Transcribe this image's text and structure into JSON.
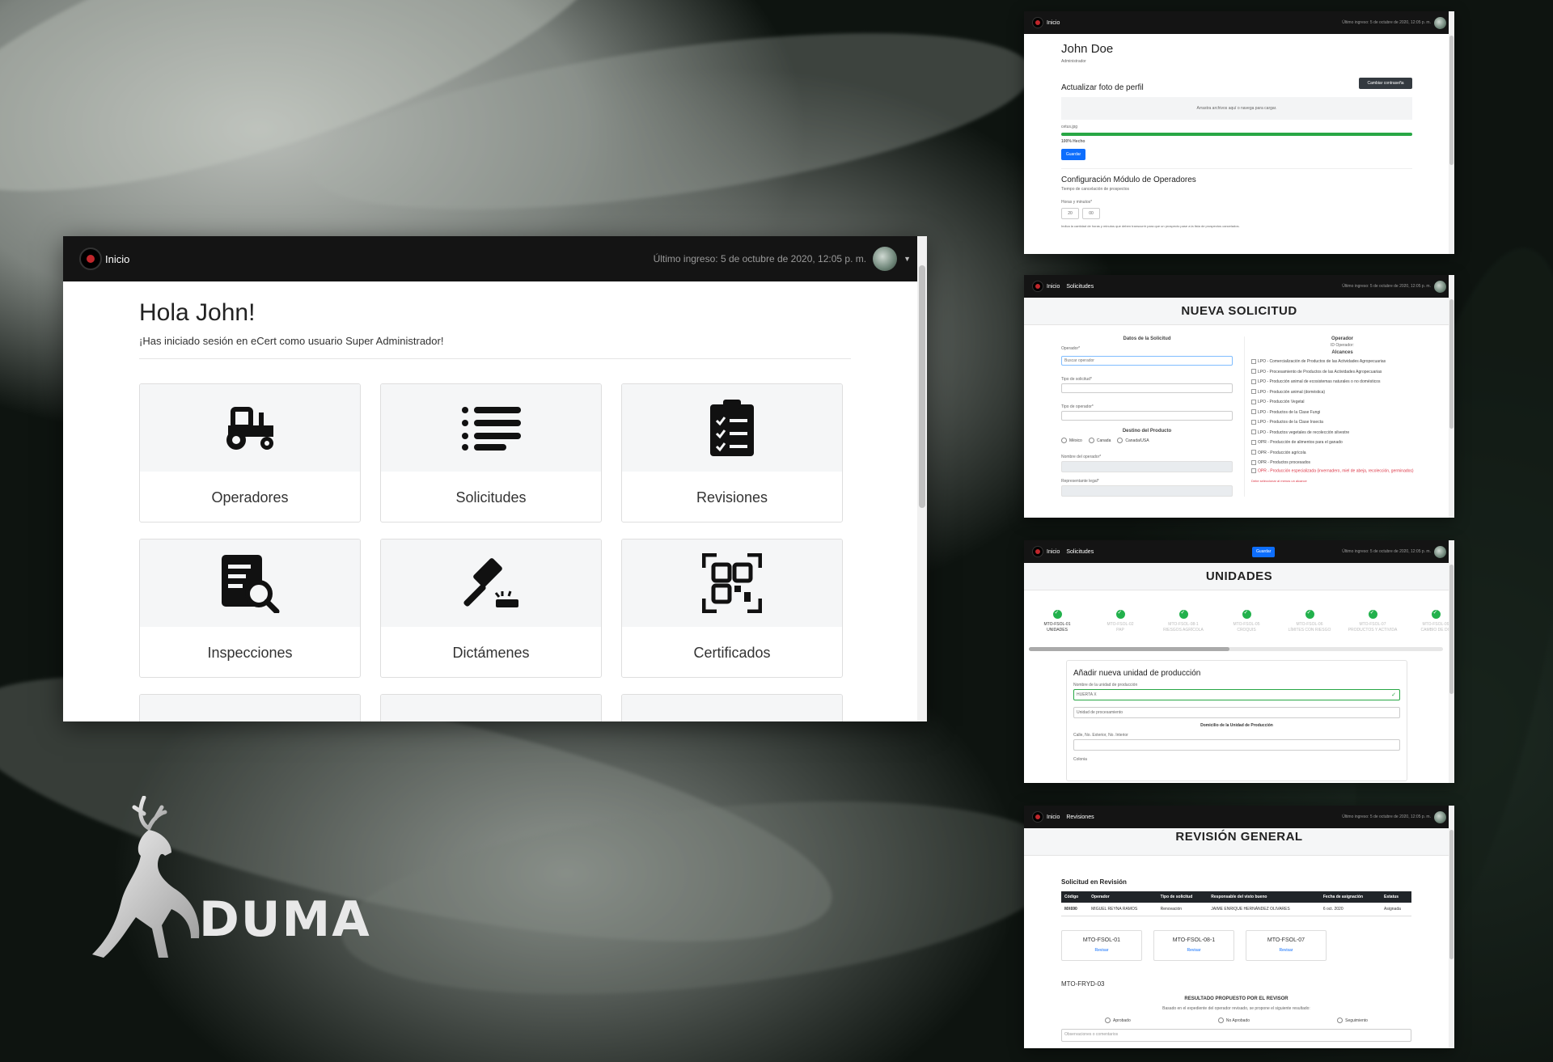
{
  "main": {
    "brand": "Inicio",
    "last_login": "Último ingreso: 5 de octubre de 2020, 12:05 p. m.",
    "greeting": "Hola John!",
    "subtitle": "¡Has iniciado sesión en eCert como usuario Super Administrador!",
    "cards": [
      {
        "label": "Operadores",
        "icon": "tractor-icon"
      },
      {
        "label": "Solicitudes",
        "icon": "list-icon"
      },
      {
        "label": "Revisiones",
        "icon": "clipboard-check-icon"
      },
      {
        "label": "Inspecciones",
        "icon": "document-search-icon"
      },
      {
        "label": "Dictámenes",
        "icon": "gavel-icon"
      },
      {
        "label": "Certificados",
        "icon": "qr-code-icon"
      }
    ]
  },
  "profile": {
    "brand": "Inicio",
    "last_login": "Último ingreso: 5 de octubre de 2020, 12:05 p. m.",
    "name": "John Doe",
    "role": "Administrador",
    "change_password": "Cambiar contraseña",
    "photo_title": "Actualizar foto de perfil",
    "dropzone_text": "Arrastra archivos aquí o navega para cargar.",
    "file_name": "cetus.jpg",
    "progress_text": "100% Hecho",
    "progress": 1.0,
    "save": "Guardar",
    "config_title": "Configuración Módulo de Operadores",
    "config_sub": "Tiempo de cancelación de prospectos",
    "hours_label": "Horas y minutos*",
    "hours": "20",
    "minutes": "00",
    "hint": "Indica la cantidad de horas y minutos que deben transcurrir para que un prospecto pase a la lista de prospectos cancelados."
  },
  "solicitud": {
    "brand": "Inicio",
    "crumb": "Solicitudes",
    "last_login": "Último ingreso: 5 de octubre de 2020, 12:05 p. m.",
    "title": "NUEVA SOLICITUD",
    "datos_title": "Datos de la Solicitud",
    "operador_label": "Operador*",
    "operador_placeholder": "Buscar operador",
    "tipo_solicitud": "Tipo de solicitud*",
    "tipo_operador": "Tipo de operador*",
    "destino_title": "Destino del Producto",
    "destinos": [
      "México",
      "Canada",
      "Canada/USA"
    ],
    "nombre_operador": "Nombre del operador*",
    "representante": "Representante legal*",
    "right_title": "Operador",
    "right_id": "ID Operador:",
    "alcances_title": "Alcances",
    "alcances": [
      "LPO - Comercialización de Productos de las Actividades Agropecuarias",
      "LPO - Procesamiento de Productos de las Actividades Agropecuarias",
      "LPO - Producción animal de ecosistemas naturales o no domésticos",
      "LPO - Producción animal (doméstica)",
      "LPO - Producción Vegetal",
      "LPO - Productos de la Clase Fungi",
      "LPO - Productos de la Clase Insecta",
      "LPO - Productos vegetales de recolección silvestre",
      "OPR - Producción de alimentos para el ganado",
      "OPR - Producción agrícola",
      "OPR - Productos procesados",
      "OPR - Producción especializada (invernadero, miel de abeja, recolección, germinados)"
    ],
    "alcances_error": "Debe seleccionar al menos un alcance"
  },
  "unidades": {
    "brand": "Inicio",
    "crumb": "Solicitudes",
    "save": "Guardar",
    "last_login": "Último ingreso: 5 de octubre de 2020, 12:05 p. m.",
    "title": "UNIDADES",
    "steps": [
      {
        "code": "MTO-FSOL-01",
        "name": "UNIDADES"
      },
      {
        "code": "MTO-FSOL-02",
        "name": "PAP"
      },
      {
        "code": "MTO-FSOL-08-1",
        "name": "RIESGOS AGRÍCOLA"
      },
      {
        "code": "MTO-FSOL-05",
        "name": "CROQUIS"
      },
      {
        "code": "MTO-FSOL-06",
        "name": "LÍMITES CON RIESGO"
      },
      {
        "code": "MTO-FSOL-07",
        "name": "PRODUCTOS Y ACTIVIDA"
      },
      {
        "code": "MTO-FSOL-09",
        "name": "CAMBIO DE DO"
      }
    ],
    "form_title": "Añadir nueva unidad de producción",
    "nombre_label": "Nombre de la unidad de producción",
    "nombre_value": "HUERTA X",
    "tipo_placeholder": "Unidad de procesamiento",
    "domicilio_title": "Domicilio de la Unidad de Producción",
    "calle_label": "Calle, No. Exterior, No. Interior",
    "colonia_label": "Colonia"
  },
  "revisiones": {
    "brand": "Inicio",
    "crumb": "Revisiones",
    "last_login": "Último ingreso: 5 de octubre de 2020, 12:05 p. m.",
    "title": "REVISIÓN GENERAL",
    "subtitle": "Solicitud en Revisión",
    "columns": [
      "Código",
      "Operador",
      "Tipo de solicitud",
      "Responsable del visto bueno",
      "Fecha de asignación",
      "Estatus"
    ],
    "row": [
      "MX690",
      "MIGUEL REYNA RAMOS",
      "Renovación",
      "JAIME ENRIQUE HERNÁNDEZ OLIVARES",
      "6 oct. 2020",
      "Asignada"
    ],
    "forms": [
      {
        "code": "MTO-FSOL-01",
        "link": "Revisar"
      },
      {
        "code": "MTO-FSOL-08-1",
        "link": "Revisar"
      },
      {
        "code": "MTO-FSOL-07",
        "link": "Revisar"
      }
    ],
    "fryd": "MTO-FRYD-03",
    "resultado_title": "RESULTADO PROPUESTO POR EL REVISOR",
    "resultado_sub": "Basado en el expediente del operador revisado, se propone el siguiente resultado:",
    "options": [
      "Aprobado",
      "No Aprobado",
      "Seguimiento"
    ],
    "obs_placeholder": "Observaciones o comentarios"
  },
  "logo": {
    "text": "DUMA"
  }
}
